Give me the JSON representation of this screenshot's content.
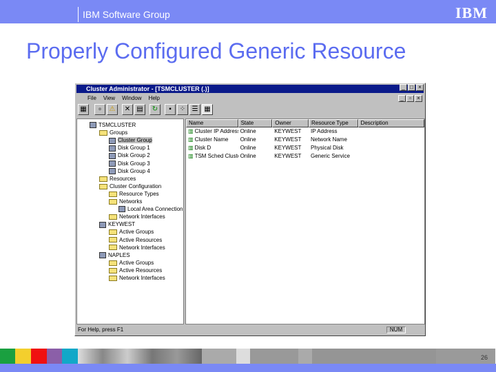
{
  "header": {
    "group": "IBM Software Group",
    "logo": "IBM"
  },
  "slide": {
    "title": "Properly Configured Generic Resource",
    "page": "26"
  },
  "window": {
    "title": "Cluster Administrator - [TSMCLUSTER (.)]",
    "menu": [
      "File",
      "View",
      "Window",
      "Help"
    ],
    "tree": [
      {
        "label": "TSMCLUSTER",
        "level": 0,
        "icon": "cluster-icon"
      },
      {
        "label": "Groups",
        "level": 1,
        "icon": "folder-icon"
      },
      {
        "label": "Cluster Group",
        "level": 2,
        "icon": "group-icon",
        "selected": true
      },
      {
        "label": "Disk Group 1",
        "level": 2,
        "icon": "group-icon"
      },
      {
        "label": "Disk Group 2",
        "level": 2,
        "icon": "group-icon"
      },
      {
        "label": "Disk Group 3",
        "level": 2,
        "icon": "group-icon"
      },
      {
        "label": "Disk Group 4",
        "level": 2,
        "icon": "group-icon"
      },
      {
        "label": "Resources",
        "level": 1,
        "icon": "folder-icon"
      },
      {
        "label": "Cluster Configuration",
        "level": 1,
        "icon": "folder-icon"
      },
      {
        "label": "Resource Types",
        "level": 2,
        "icon": "folder-icon"
      },
      {
        "label": "Networks",
        "level": 2,
        "icon": "folder-icon"
      },
      {
        "label": "Local Area Connection",
        "level": 3,
        "icon": "network-icon"
      },
      {
        "label": "Network Interfaces",
        "level": 2,
        "icon": "folder-icon"
      },
      {
        "label": "KEYWEST",
        "level": 1,
        "icon": "node-icon"
      },
      {
        "label": "Active Groups",
        "level": 2,
        "icon": "folder-icon"
      },
      {
        "label": "Active Resources",
        "level": 2,
        "icon": "folder-icon"
      },
      {
        "label": "Network Interfaces",
        "level": 2,
        "icon": "folder-icon"
      },
      {
        "label": "NAPLES",
        "level": 1,
        "icon": "node-icon"
      },
      {
        "label": "Active Groups",
        "level": 2,
        "icon": "folder-icon"
      },
      {
        "label": "Active Resources",
        "level": 2,
        "icon": "folder-icon"
      },
      {
        "label": "Network Interfaces",
        "level": 2,
        "icon": "folder-icon"
      }
    ],
    "columns": [
      "Name",
      "State",
      "Owner",
      "Resource Type",
      "Description"
    ],
    "rows": [
      [
        "Cluster IP Address",
        "Online",
        "KEYWEST",
        "IP Address",
        ""
      ],
      [
        "Cluster Name",
        "Online",
        "KEYWEST",
        "Network Name",
        ""
      ],
      [
        "Disk D",
        "Online",
        "KEYWEST",
        "Physical Disk",
        ""
      ],
      [
        "TSM Sched Cluster Group",
        "Online",
        "KEYWEST",
        "Generic Service",
        ""
      ]
    ],
    "status": "For Help, press F1",
    "num": "NUM"
  },
  "colors": {
    "header": "#7a89f5",
    "title": "#5b6cf0",
    "strip": [
      "#1aa040",
      "#f3cf2d",
      "#f01010",
      "#8b5fa8",
      "#12a8c8"
    ]
  }
}
